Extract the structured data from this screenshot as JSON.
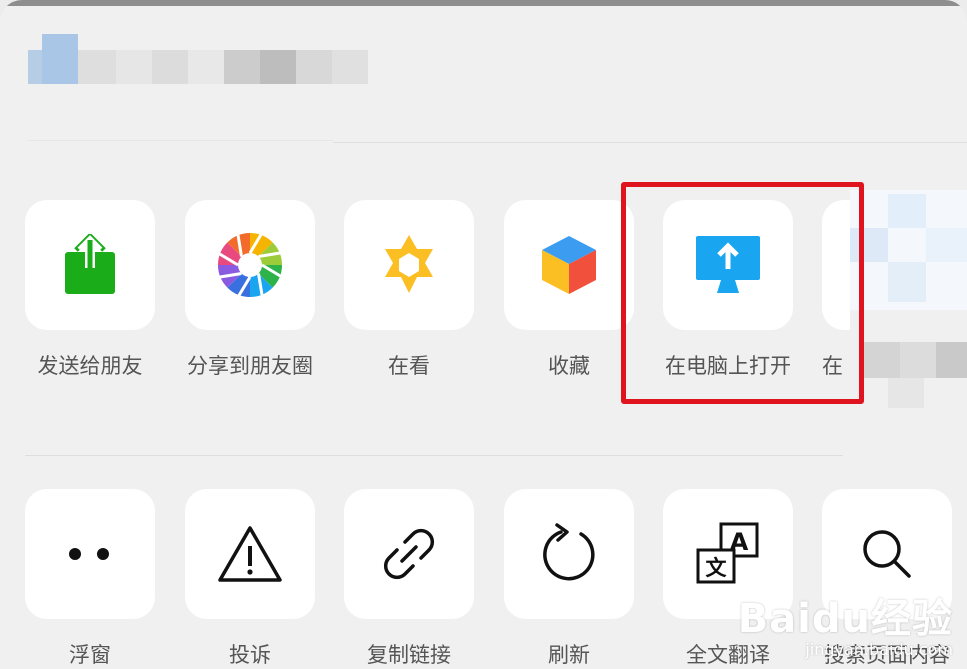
{
  "share_sheet": {
    "row1": [
      {
        "label": "发送给朋友",
        "icon": "send-to-friend-icon"
      },
      {
        "label": "分享到朋友圈",
        "icon": "moments-shutter-icon"
      },
      {
        "label": "在看",
        "icon": "wow-star-icon"
      },
      {
        "label": "收藏",
        "icon": "favorite-cube-icon"
      },
      {
        "label": "在电脑上打开",
        "icon": "open-on-computer-icon"
      },
      {
        "label": "在",
        "icon": "partial-icon"
      }
    ],
    "row2": [
      {
        "label": "浮窗",
        "icon": "float-window-icon"
      },
      {
        "label": "投诉",
        "icon": "warning-icon"
      },
      {
        "label": "复制链接",
        "icon": "link-icon"
      },
      {
        "label": "刷新",
        "icon": "refresh-icon"
      },
      {
        "label": "全文翻译",
        "icon": "translate-icon"
      },
      {
        "label": "搜索页面内容",
        "icon": "search-icon"
      }
    ]
  },
  "watermark": {
    "brand": "Baidu经验",
    "url": "jingyan.baidu.com"
  },
  "colors": {
    "highlight": "#e0141e",
    "send_green": "#1aad19",
    "computer_blue": "#1aa5f0"
  }
}
